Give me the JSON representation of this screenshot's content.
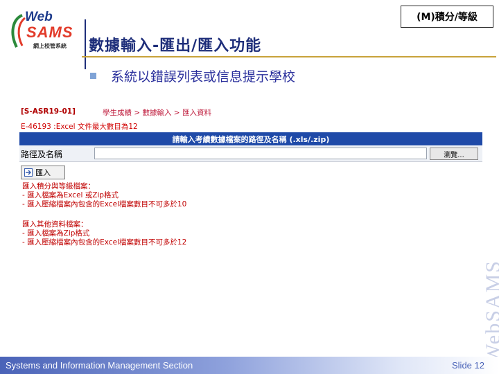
{
  "logo": {
    "web": "Web",
    "sams": "SAMS",
    "sub": "網上校管系統"
  },
  "grade_box": "(M)積分/等級",
  "title": "數據輸入-匯出/匯入功能",
  "bullet": "系統以錯誤列表或信息提示學校",
  "form": {
    "path_code": "[S-ASR19-01]",
    "breadcrumb": "學生成績 > 數據輸入 > 匯入資料",
    "error": "E-46193 :Excel 文件最大數目為12",
    "header": "請輸入考績數據檔案的路徑及名稱 (.xls/.zip)",
    "field_label": "路徑及名稱",
    "browse_label": "瀏覽...",
    "import_label": "匯入",
    "notes_group1": [
      "匯入積分與等級檔案：",
      "- 匯入檔案為Excel 或Zip格式",
      "- 匯入壓縮檔案內包含的Excel檔案數目不可多於10"
    ],
    "notes_group2": [
      "匯入其他資料檔案：",
      "- 匯入檔案為Zip格式",
      "- 匯入壓縮檔案內包含的Excel檔案數目不可多於12"
    ]
  },
  "watermark": "WebSAMS",
  "footer": {
    "left": "Systems and Information Management Section",
    "right": "Slide 12"
  },
  "colors": {
    "title": "#1e2e7a",
    "bullet_text": "#2a2f9c",
    "form_header": "#1f4aa8",
    "error": "#d00000"
  }
}
